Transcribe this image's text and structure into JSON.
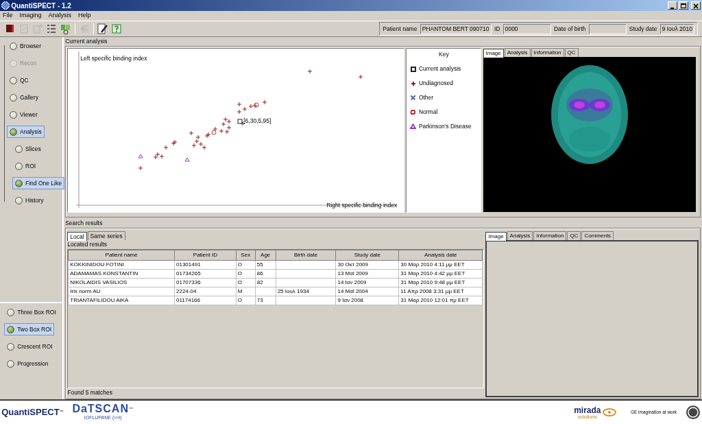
{
  "window": {
    "title": "QuantiSPECT - 1.2"
  },
  "menu": [
    "File",
    "Imaging",
    "Analysis",
    "Help"
  ],
  "toolbar": [
    {
      "disabled": false
    },
    {
      "disabled": true
    },
    {
      "disabled": true
    },
    {
      "disabled": false
    },
    {
      "disabled": false
    },
    {
      "disabled": true
    },
    {
      "disabled": false
    },
    {
      "disabled": false
    }
  ],
  "patient_fields": [
    {
      "label": "Patient name",
      "value": "PHANTOM BERT 090710"
    },
    {
      "label": "ID",
      "value": "0000"
    },
    {
      "label": "Date of birth"
    },
    {
      "label": "Study date",
      "value": "9 Ιουλ 2010"
    }
  ],
  "sidebar": {
    "items": [
      {
        "label": "Browser",
        "disabled": false,
        "selected": false
      },
      {
        "label": "Recon",
        "disabled": true,
        "selected": false
      },
      {
        "label": "QC",
        "disabled": false,
        "selected": false
      },
      {
        "label": "Gallery",
        "disabled": false,
        "selected": false
      },
      {
        "label": "Viewer",
        "disabled": false,
        "selected": false
      },
      {
        "label": "Analysis",
        "disabled": false,
        "selected": true,
        "children": [
          {
            "label": "Slices",
            "disabled": false,
            "selected": false
          },
          {
            "label": "ROI",
            "disabled": false,
            "selected": false
          },
          {
            "label": "Find One Like",
            "disabled": false,
            "selected": true
          },
          {
            "label": "History",
            "disabled": false,
            "selected": false
          }
        ]
      }
    ],
    "methods": [
      {
        "label": "Three Box ROI",
        "selected": false
      },
      {
        "label": "Two Box ROI",
        "selected": true
      },
      {
        "label": "Crescent ROI",
        "selected": false
      },
      {
        "label": "Progression",
        "selected": false
      }
    ]
  },
  "current_analysis": {
    "title": "Current analysis",
    "ylabel": "Left specific binding index",
    "xlabel": "Right specific binding index",
    "point_label": "[6,30,5,95]",
    "key": {
      "title": "Key",
      "items": [
        {
          "kind": "square",
          "label": "Current analysis",
          "color": "#222222"
        },
        {
          "kind": "plus",
          "label": "Undiagnosed",
          "color": "#8b2020"
        },
        {
          "kind": "cross",
          "label": "Other",
          "color": "#5a6aa0"
        },
        {
          "kind": "circle",
          "label": "Normal",
          "color": "#c03030"
        },
        {
          "kind": "triangle",
          "label": "Parkinson's Disease",
          "color": "#a030c0"
        }
      ]
    },
    "image_tabs": [
      {
        "label": "Image",
        "selected": true
      },
      {
        "label": "Analysis",
        "selected": false
      },
      {
        "label": "Information",
        "selected": false
      },
      {
        "label": "QC",
        "selected": false
      }
    ]
  },
  "search_results": {
    "title": "Search results",
    "tabs": [
      {
        "label": "Local",
        "selected": true
      },
      {
        "label": "Same series",
        "selected": false
      }
    ],
    "subtitle": "Located results",
    "columns": [
      "Patient name",
      "Patient ID",
      "Sex",
      "Age",
      "Birth date",
      "Study date",
      "Analysis date"
    ],
    "rows": [
      [
        "KOKKINIDOU FOTINI",
        "01301491",
        "O",
        "55",
        "",
        "30 Οκτ 2009",
        "30 Μαρ 2010  4:11 μμ EET"
      ],
      [
        "ADAMAMAS KONSTANTIN",
        "01734265",
        "O",
        "86",
        "",
        "13 Μαϊ 2009",
        "31 Μαρ 2010  4:42 μμ EET"
      ],
      [
        "NIKOLAIDIS VASILIOS",
        "01707336",
        "O",
        "82",
        "",
        "14 Ιαν 2009",
        "31 Μαρ 2010  9:48 μμ EET"
      ],
      [
        "Irix norm AU",
        "2224-04",
        "M",
        "",
        "25 Ιουλ 1934",
        "14 Μαϊ 2004",
        "11 Απρ 2008  3:31 μμ EET"
      ],
      [
        "TRIANTAFILIDOU AIKA",
        "01174166",
        "O",
        "73",
        "",
        "9 Ιαν 2008",
        "31 Μαρ 2010  12:01 πμ EET"
      ]
    ],
    "status": "Found 5 matches",
    "detail_tabs": [
      {
        "label": "Image",
        "selected": true
      },
      {
        "label": "Analysis",
        "selected": false
      },
      {
        "label": "Information",
        "selected": false
      },
      {
        "label": "QC",
        "selected": false
      },
      {
        "label": "Comments",
        "selected": false
      }
    ]
  },
  "footer": {
    "product": "QuantiSPECT",
    "product_mark": "™",
    "brand": "DaTSCAN",
    "brand_mark": "™",
    "brand_sub": "IOFLUPANE (¹²³I)",
    "partner": "mirada",
    "partner_sub": "solutions",
    "tagline": "GE imagination at work"
  }
}
